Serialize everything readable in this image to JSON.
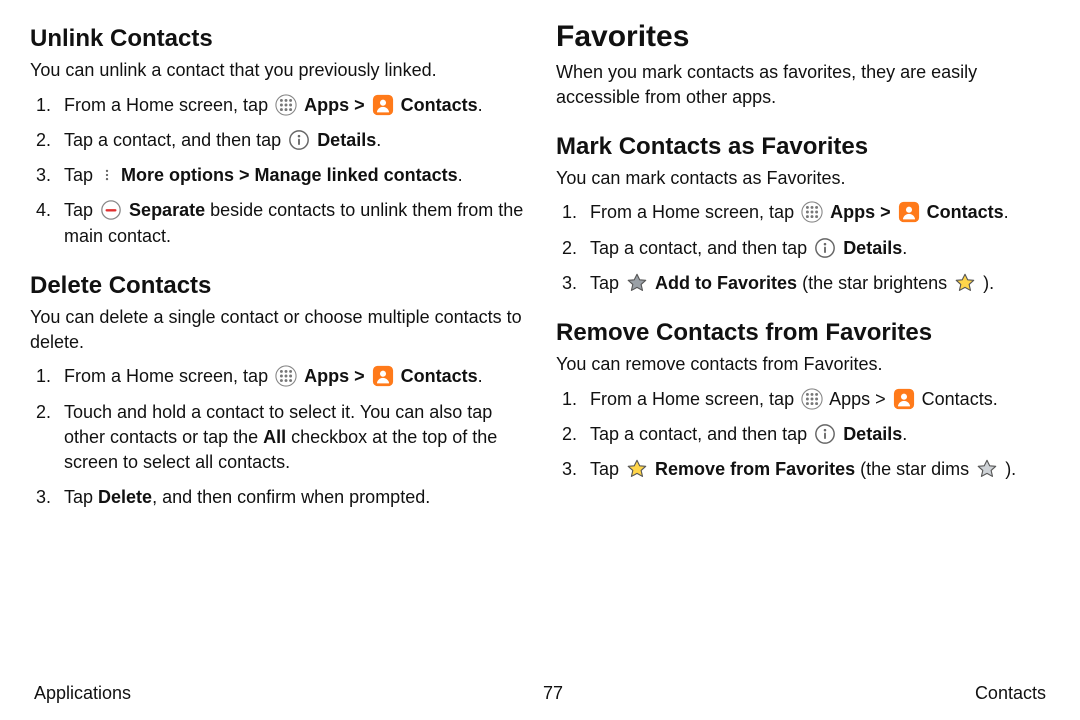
{
  "footer": {
    "left": "Applications",
    "center": "77",
    "right": "Contacts"
  },
  "labels": {
    "apps": "Apps",
    "contacts": "Contacts",
    "details": "Details",
    "more_manage": "More options > Manage linked contacts",
    "separate": "Separate",
    "delete_b": "Delete",
    "all_b": "All",
    "add_fav": "Add to Favorites",
    "rem_fav": "Remove from Favorites"
  },
  "left": {
    "unlink": {
      "h": "Unlink Contacts",
      "p": "You can unlink a contact that you previously linked.",
      "s1a": "From a Home screen, tap ",
      "s1b": " > ",
      "s1c": ".",
      "s2a": "Tap a contact, and then tap ",
      "s2b": ".",
      "s3a": "Tap ",
      "s3b": ".",
      "s4a": "Tap ",
      "s4b": " beside contacts to unlink them from the main contact."
    },
    "delete": {
      "h": "Delete Contacts",
      "p": "You can delete a single contact or choose multiple contacts to delete.",
      "s1a": "From a Home screen, tap ",
      "s1b": " > ",
      "s1c": ".",
      "s2a": "Touch and hold a contact to select it. You can also tap other contacts or tap the ",
      "s2b": " checkbox at the top of the screen to select all contacts.",
      "s3a": "Tap ",
      "s3b": ", and then confirm when prompted."
    }
  },
  "right": {
    "fav": {
      "h": "Favorites",
      "p": "When you mark contacts as favorites, they are easily accessible from other apps."
    },
    "mark": {
      "h": "Mark Contacts as Favorites",
      "p": "You can mark contacts as Favorites.",
      "s1a": "From a Home screen, tap ",
      "s1b": " > ",
      "s1c": ".",
      "s2a": "Tap a contact, and then tap ",
      "s2b": ".",
      "s3a": "Tap ",
      "s3b": " (the star brightens ",
      "s3c": ")."
    },
    "remove": {
      "h": "Remove Contacts from Favorites",
      "p": "You can remove contacts from Favorites.",
      "s1a": "From a Home screen, tap ",
      "s1b": " Apps > ",
      "s1c": " Contacts.",
      "s2a": "Tap a contact, and then tap ",
      "s2b": ".",
      "s3a": "Tap ",
      "s3b": " (the star dims ",
      "s3c": ")."
    }
  }
}
